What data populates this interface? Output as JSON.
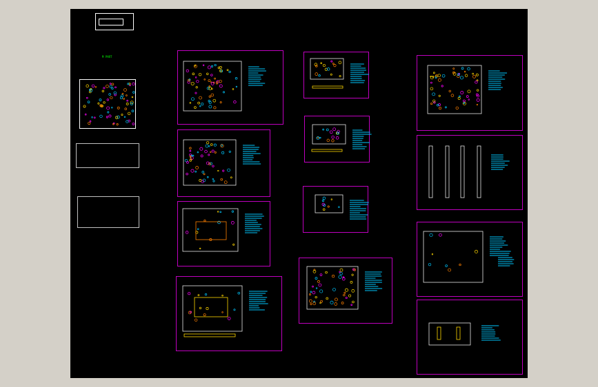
{
  "viewer": {
    "background": "#d4d0c8",
    "canvas_color": "#000000",
    "border_color": "#c000c0",
    "hole_yellow": "#ffd700",
    "hole_cyan": "#00c8ff",
    "hole_magenta": "#ff00ff",
    "hole_orange": "#ff8000"
  },
  "drawing": {
    "section_tag": "M PART"
  }
}
